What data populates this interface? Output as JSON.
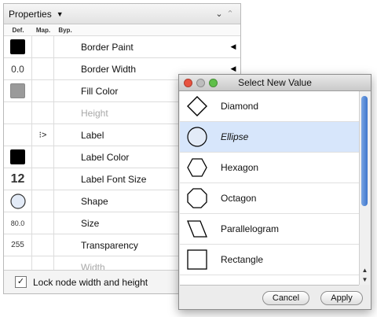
{
  "panel": {
    "title": "Properties",
    "columns": {
      "def": "Def.",
      "map": "Map.",
      "byp": "Byp."
    },
    "rows": [
      {
        "name": "Border Paint",
        "def": "",
        "def_kind": "black",
        "map": "",
        "disabled": false,
        "arrow": "◀"
      },
      {
        "name": "Border Width",
        "def": "0.0",
        "def_kind": "num",
        "map": "",
        "disabled": false,
        "arrow": "◀"
      },
      {
        "name": "Fill Color",
        "def": "",
        "def_kind": "gray",
        "map": "",
        "disabled": false,
        "arrow": ""
      },
      {
        "name": "Height",
        "def": "",
        "def_kind": "none",
        "map": "",
        "disabled": true,
        "arrow": ""
      },
      {
        "name": "Label",
        "def": "",
        "def_kind": "none",
        "map": "⁝>",
        "disabled": false,
        "arrow": ""
      },
      {
        "name": "Label Color",
        "def": "",
        "def_kind": "black",
        "map": "",
        "disabled": false,
        "arrow": ""
      },
      {
        "name": "Label Font Size",
        "def": "12",
        "def_kind": "big",
        "map": "",
        "disabled": false,
        "arrow": ""
      },
      {
        "name": "Shape",
        "def": "",
        "def_kind": "ellipse",
        "map": "",
        "disabled": false,
        "arrow": ""
      },
      {
        "name": "Size",
        "def": "80.0",
        "def_kind": "small",
        "map": "",
        "disabled": false,
        "arrow": ""
      },
      {
        "name": "Transparency",
        "def": "255",
        "def_kind": "mid",
        "map": "",
        "disabled": false,
        "arrow": ""
      },
      {
        "name": "Width",
        "def": "",
        "def_kind": "none",
        "map": "",
        "disabled": true,
        "arrow": ""
      }
    ],
    "footer": {
      "label": "Lock node width and height",
      "checked": true,
      "check_glyph": "✓"
    }
  },
  "dialog": {
    "title": "Select New Value",
    "items": [
      {
        "label": "Diamond",
        "icon": "diamond-shape-icon",
        "selected": false,
        "italic": false
      },
      {
        "label": "Ellipse",
        "icon": "ellipse-shape-icon",
        "selected": true,
        "italic": true
      },
      {
        "label": "Hexagon",
        "icon": "hexagon-shape-icon",
        "selected": false,
        "italic": false
      },
      {
        "label": "Octagon",
        "icon": "octagon-shape-icon",
        "selected": false,
        "italic": false
      },
      {
        "label": "Parallelogram",
        "icon": "parallelogram-shape-icon",
        "selected": false,
        "italic": false
      },
      {
        "label": "Rectangle",
        "icon": "rectangle-shape-icon",
        "selected": false,
        "italic": false
      },
      {
        "label": "",
        "icon": "partial-shape-icon",
        "selected": false,
        "italic": false
      }
    ],
    "cancel_label": "Cancel",
    "apply_label": "Apply"
  },
  "colors": {
    "selection": "#d7e6fb",
    "scroll_thumb": "#3e76cc"
  }
}
